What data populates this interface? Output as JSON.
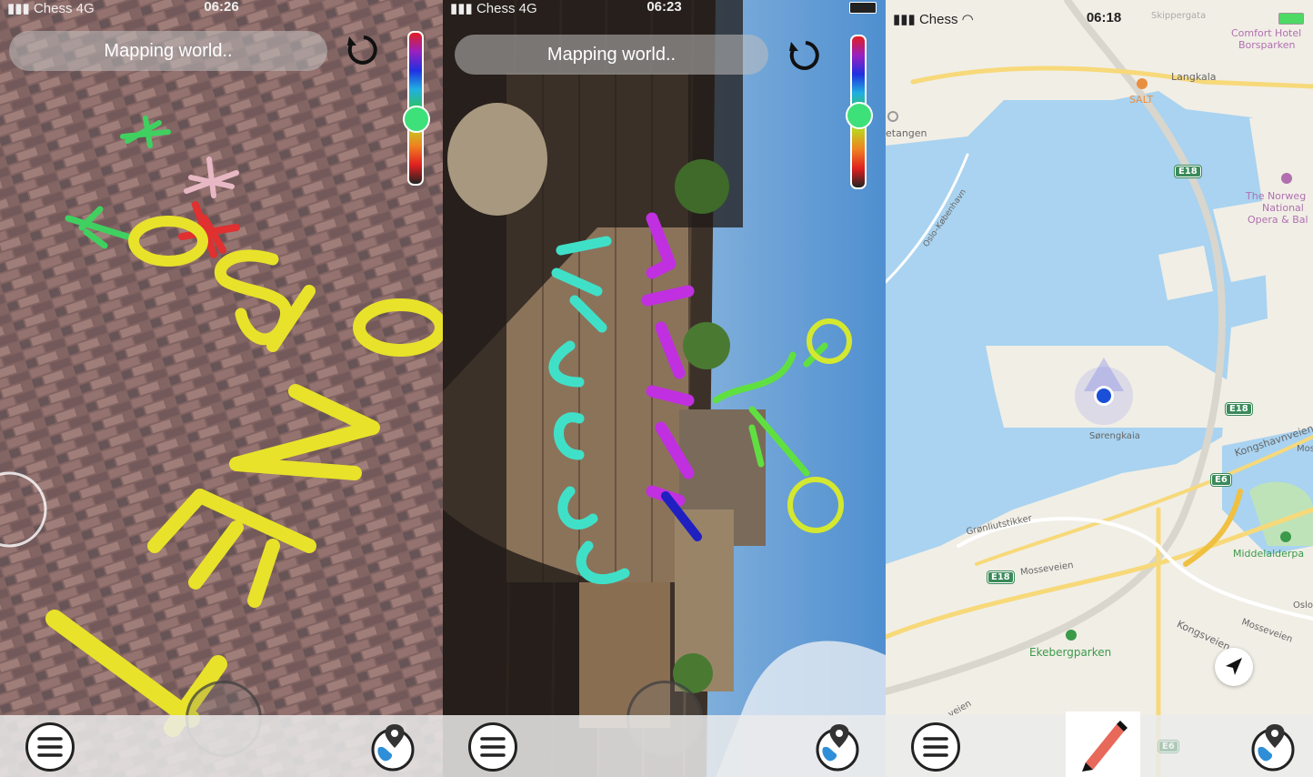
{
  "screens": [
    {
      "status": {
        "carrier": "Chess",
        "network": "4G",
        "time": "06:26"
      },
      "banner": "Mapping world.."
    },
    {
      "status": {
        "carrier": "Chess",
        "network": "4G",
        "time": "06:23"
      },
      "banner": "Mapping world.."
    },
    {
      "status": {
        "carrier": "Chess",
        "time": "06:18"
      },
      "map_labels": {
        "skippergata": "Skippergata",
        "hotel": "Comfort Hotel",
        "hotel2": "Borsparken",
        "langkala": "Langkala",
        "salt": "SALT",
        "tangen": "etangen",
        "opera1": "The Norweg",
        "opera2": "National",
        "opera3": "Opera & Bal",
        "oslokbh": "Oslo–København",
        "sorengkaia": "Sørengkaia",
        "kongshavnveien": "Kongshavnveien",
        "mos": "Mos",
        "gronlia": "Grønliutstikker",
        "mosseveien1": "Mosseveien",
        "mosseveien2": "Mosseveien",
        "middelalder": "Middelalderpa",
        "kongsveien": "Kongsveien",
        "ekeberg": "Ekebergparken",
        "oslo": "Oslo",
        "veien": "veien"
      },
      "shields": {
        "e18a": "E18",
        "e18b": "E18",
        "e18c": "E18",
        "e6a": "E6",
        "e6b": "E6"
      }
    }
  ],
  "colors": {
    "sketch_yellow": "#e8e22a",
    "sketch_purple": "#c030e0",
    "sketch_teal": "#40e0c8",
    "sketch_green": "#60e040",
    "water": "#a9d3f0",
    "land": "#f1eee6",
    "road": "#f7d97a",
    "location_dot": "#1a4fd8"
  },
  "icons": [
    "menu-icon",
    "globe-pin-icon",
    "undo-icon",
    "pencil-icon",
    "navigation-arrow-icon",
    "wifi-icon",
    "signal-icon",
    "battery-icon",
    "location-arrow-icon"
  ]
}
